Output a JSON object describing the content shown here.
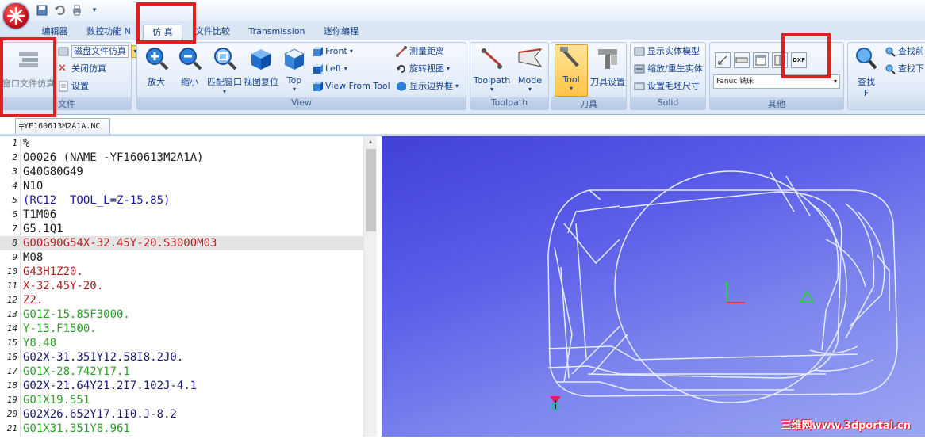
{
  "qat": {
    "icons": [
      "save-icon",
      "undo-icon",
      "print-icon",
      "customize-icon"
    ]
  },
  "tabs": [
    {
      "label": "编辑器"
    },
    {
      "label": "数控功能 N"
    },
    {
      "label": "仿 真"
    },
    {
      "label": "文件比较"
    },
    {
      "label": "Transmission"
    },
    {
      "label": "迷你编程"
    }
  ],
  "ribbon": {
    "file_group": {
      "label": "文件",
      "window_sim": "窗口文件仿真",
      "disk_sim": "磁盘文件仿真",
      "close_sim": "关闭仿真",
      "settings": "设置"
    },
    "view_group": {
      "label": "View",
      "zoom_in": "放大",
      "zoom_out": "缩小",
      "fit_window": "匹配窗口",
      "view_reset": "视图复位",
      "top": "Top",
      "front": "Front",
      "left": "Left",
      "view_from_tool": "View From Tool",
      "measure": "测量距离",
      "rotate": "旋转视图",
      "show_bounds": "显示边界框"
    },
    "toolpath_group": {
      "label": "Toolpath",
      "toolpath": "Toolpath",
      "mode": "Mode"
    },
    "tool_group": {
      "label": "刀具",
      "tool": "Tool",
      "tool_settings": "刀具设置"
    },
    "solid_group": {
      "label": "Solid",
      "show_solid": "显示实体模型",
      "reset_solid": "缩放/重生实体",
      "stock_size": "设置毛坯尺寸"
    },
    "other_group": {
      "label": "其他",
      "machine": "Fanuc 铣床",
      "dxf": "DXF"
    },
    "find_group": {
      "find": "查找",
      "find_f": "F",
      "find_prev": "查找前",
      "find_next": "查找下"
    }
  },
  "document": {
    "tab_label": "YF160613M2A1A.NC"
  },
  "editor": {
    "lines": [
      {
        "n": "1",
        "text": "%",
        "color": "#1a1a1a"
      },
      {
        "n": "2",
        "text": "O0026 (NAME -YF160613M2A1A)",
        "color": "#1a1a1a"
      },
      {
        "n": "3",
        "text": "G40G80G49",
        "color": "#1a1a1a"
      },
      {
        "n": "4",
        "text": "N10",
        "color": "#1a1a1a"
      },
      {
        "n": "5",
        "text": "(RC12  TOOL_L=Z-15.85)",
        "color": "#1a1aa0"
      },
      {
        "n": "6",
        "text": "T1M06",
        "color": "#1a1a1a"
      },
      {
        "n": "7",
        "text": "G5.1Q1",
        "color": "#1a1a1a"
      },
      {
        "n": "8",
        "text": "G00G90G54X-32.45Y-20.S3000M03",
        "color": "#b22222"
      },
      {
        "n": "9",
        "text": "M08",
        "color": "#1a1a1a"
      },
      {
        "n": "10",
        "text": "G43H1Z20.",
        "color": "#b22222"
      },
      {
        "n": "11",
        "text": "X-32.45Y-20.",
        "color": "#b22222"
      },
      {
        "n": "12",
        "text": "Z2.",
        "color": "#b22222"
      },
      {
        "n": "13",
        "text": "G01Z-15.85F3000.",
        "color": "#2ca02c"
      },
      {
        "n": "14",
        "text": "Y-13.F1500.",
        "color": "#2ca02c"
      },
      {
        "n": "15",
        "text": "Y8.48",
        "color": "#2ca02c"
      },
      {
        "n": "16",
        "text": "G02X-31.351Y12.58I8.2J0.",
        "color": "#1a1a6e"
      },
      {
        "n": "17",
        "text": "G01X-28.742Y17.1",
        "color": "#2ca02c"
      },
      {
        "n": "18",
        "text": "G02X-21.64Y21.2I7.102J-4.1",
        "color": "#1a1a6e"
      },
      {
        "n": "19",
        "text": "G01X19.551",
        "color": "#2ca02c"
      },
      {
        "n": "20",
        "text": "G02X26.652Y17.1I0.J-8.2",
        "color": "#1a1a6e"
      },
      {
        "n": "21",
        "text": "G01X31.351Y8.961",
        "color": "#2ca02c"
      }
    ],
    "highlight_line": "8"
  },
  "viewport": {
    "watermark": "三维网www.3dportal.cn"
  }
}
